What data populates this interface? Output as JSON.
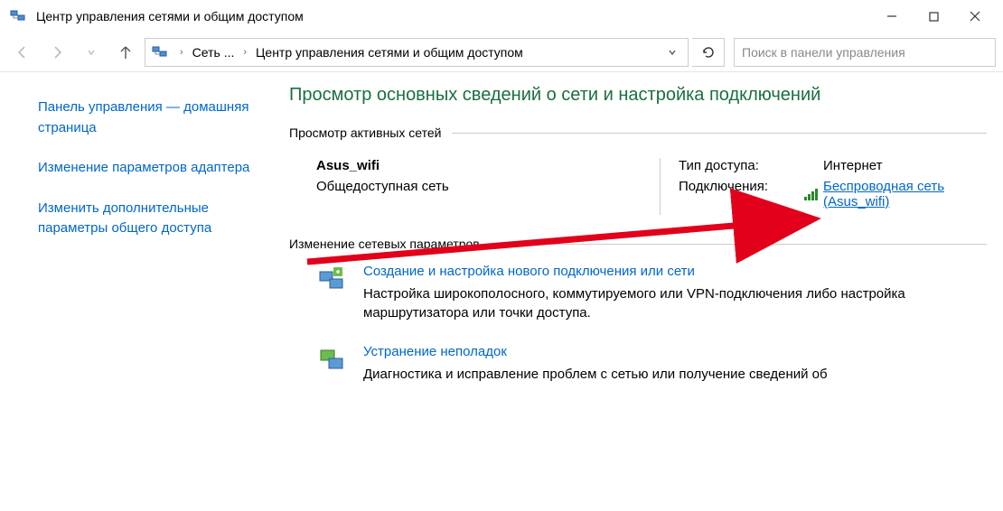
{
  "window": {
    "title": "Центр управления сетями и общим доступом"
  },
  "address": {
    "seg1": "Сеть ...",
    "seg2": "Центр управления сетями и общим доступом"
  },
  "search": {
    "placeholder": "Поиск в панели управления"
  },
  "sidebar": {
    "home": "Панель управления — домашняя страница",
    "adapter": "Изменение параметров адаптера",
    "sharing": "Изменить дополнительные параметры общего доступа"
  },
  "main": {
    "heading": "Просмотр основных сведений о сети и настройка подключений",
    "active_title": "Просмотр активных сетей",
    "change_title": "Изменение сетевых параметров"
  },
  "network": {
    "name": "Asus_wifi",
    "profile": "Общедоступная сеть",
    "access_label": "Тип доступа:",
    "access_value": "Интернет",
    "conn_label": "Подключения:",
    "conn_link": "Беспроводная сеть (Asus_wifi)"
  },
  "tasks": {
    "new_conn_title": "Создание и настройка нового подключения или сети",
    "new_conn_desc": "Настройка широкополосного, коммутируемого или VPN-подключения либо настройка маршрутизатора или точки доступа.",
    "troubleshoot_title": "Устранение неполадок",
    "troubleshoot_desc": "Диагностика и исправление проблем с сетью или получение сведений об"
  }
}
